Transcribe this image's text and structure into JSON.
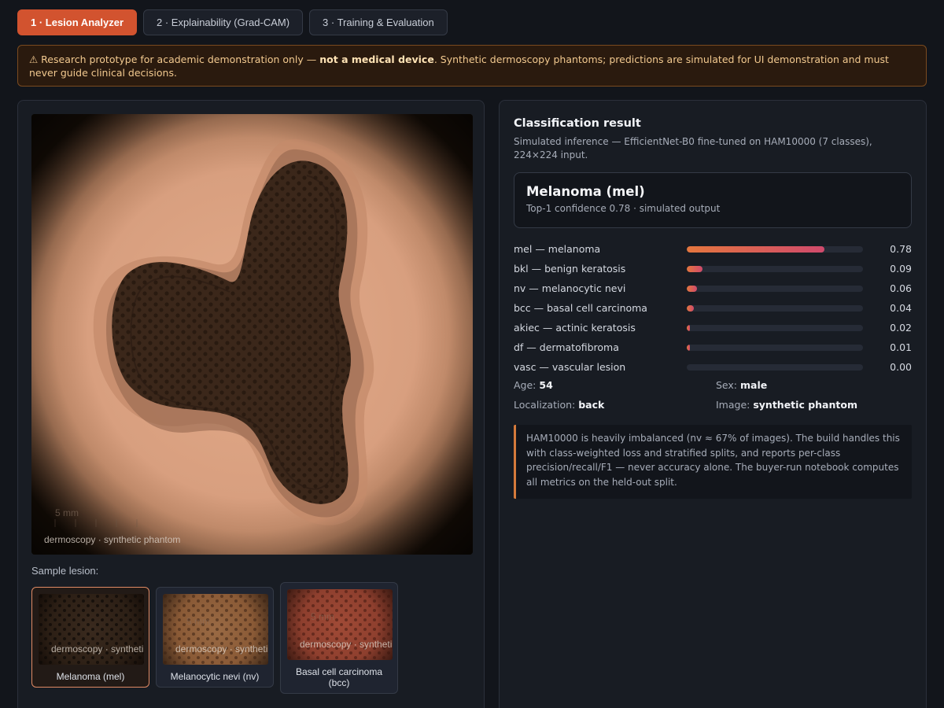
{
  "tabs": [
    {
      "label": "1 · Lesion Analyzer",
      "active": true
    },
    {
      "label": "2 · Explainability (Grad-CAM)",
      "active": false
    },
    {
      "label": "3 · Training & Evaluation",
      "active": false
    }
  ],
  "banner": {
    "icon": "warning-icon",
    "prefix": "⚠ Research prototype for academic demonstration only — ",
    "bold": "not a medical device",
    "suffix": ". Synthetic dermoscopy phantoms; predictions are simulated for UI demonstration and must never guide clinical decisions."
  },
  "viewer": {
    "scale_label": "5 mm",
    "caption": "dermoscopy · synthetic phantom"
  },
  "samples": {
    "label": "Sample lesion:",
    "items": [
      {
        "name": "Melanoma (mel)",
        "caption": "dermoscopy · syntheti",
        "scale": "",
        "selected": true,
        "tone": "#3a2a1e"
      },
      {
        "name": "Melanocytic nevi (nv)",
        "caption": "dermoscopy · syntheti",
        "scale": "5 mm",
        "selected": false,
        "tone": "#8a5a36"
      },
      {
        "name": "Basal cell carcinoma (bcc)",
        "caption": "dermoscopy · syntheti",
        "scale": "5 mm",
        "selected": false,
        "tone": "#8e3f2e"
      }
    ]
  },
  "result": {
    "title": "Classification result",
    "subtitle": "Simulated inference — EfficientNet-B0 fine-tuned on HAM10000 (7 classes), 224×224 input.",
    "top1": "Melanoma (mel)",
    "confidence": "Top-1 confidence 0.78 · simulated output",
    "probabilities": [
      {
        "label": "mel — melanoma",
        "value": 0.78,
        "text": "0.78"
      },
      {
        "label": "bkl — benign keratosis",
        "value": 0.09,
        "text": "0.09"
      },
      {
        "label": "nv — melanocytic nevi",
        "value": 0.06,
        "text": "0.06"
      },
      {
        "label": "bcc — basal cell carcinoma",
        "value": 0.04,
        "text": "0.04"
      },
      {
        "label": "akiec — actinic keratosis",
        "value": 0.02,
        "text": "0.02"
      },
      {
        "label": "df — dermatofibroma",
        "value": 0.01,
        "text": "0.01"
      },
      {
        "label": "vasc — vascular lesion",
        "value": 0.0,
        "text": "0.00"
      }
    ]
  },
  "metadata": {
    "age_label": "Age:",
    "age": "54",
    "sex_label": "Sex:",
    "sex": "male",
    "loc_label": "Localization:",
    "loc": "back",
    "image_label": "Image:",
    "image": "synthetic phantom"
  },
  "note": "HAM10000 is heavily imbalanced (nv ≈ 67% of images). The build handles this with class-weighted loss and stratified splits, and reports per-class precision/recall/F1 — never accuracy alone. The buyer-run notebook computes all metrics on the held-out split.",
  "colors": {
    "accent": "#d2532f",
    "bar_start": "#e4763e",
    "bar_end": "#d04a6c",
    "warning_bg": "#2a1a0e"
  }
}
